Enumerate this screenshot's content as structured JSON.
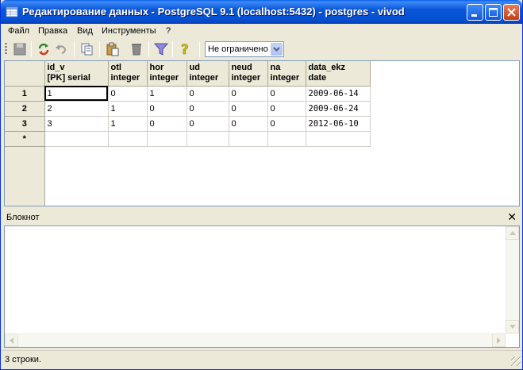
{
  "window": {
    "title": "Редактирование данных - PostgreSQL 9.1 (localhost:5432) - postgres - vivod"
  },
  "menu": [
    {
      "label": "Файл"
    },
    {
      "label": "Правка"
    },
    {
      "label": "Вид"
    },
    {
      "label": "Инструменты"
    },
    {
      "label": "?"
    }
  ],
  "toolbar": {
    "icons": [
      "save-icon",
      "refresh-icon",
      "undo-icon",
      "copy-icon",
      "paste-icon",
      "delete-icon",
      "filter-icon",
      "help-icon"
    ],
    "limit_value": "Не ограничено"
  },
  "grid": {
    "columns": [
      {
        "name": "id_v",
        "type": "[PK] serial"
      },
      {
        "name": "otl",
        "type": "integer"
      },
      {
        "name": "hor",
        "type": "integer"
      },
      {
        "name": "ud",
        "type": "integer"
      },
      {
        "name": "neud",
        "type": "integer"
      },
      {
        "name": "na",
        "type": "integer"
      },
      {
        "name": "data_ekz",
        "type": "date"
      }
    ],
    "rows": [
      {
        "num": "1",
        "cells": [
          "1",
          "0",
          "1",
          "0",
          "0",
          "0",
          "2009-06-14"
        ]
      },
      {
        "num": "2",
        "cells": [
          "2",
          "1",
          "0",
          "0",
          "0",
          "0",
          "2009-06-24"
        ]
      },
      {
        "num": "3",
        "cells": [
          "3",
          "1",
          "0",
          "0",
          "0",
          "0",
          "2012-06-10"
        ]
      }
    ],
    "new_row_marker": "*"
  },
  "notepad": {
    "label": "Блокнот",
    "close": "✕"
  },
  "status": {
    "text": "3 строки."
  },
  "colors": {
    "title_bar": "#0551D3",
    "window_bg": "#ECE9D8",
    "border": "#7F9DB9"
  }
}
